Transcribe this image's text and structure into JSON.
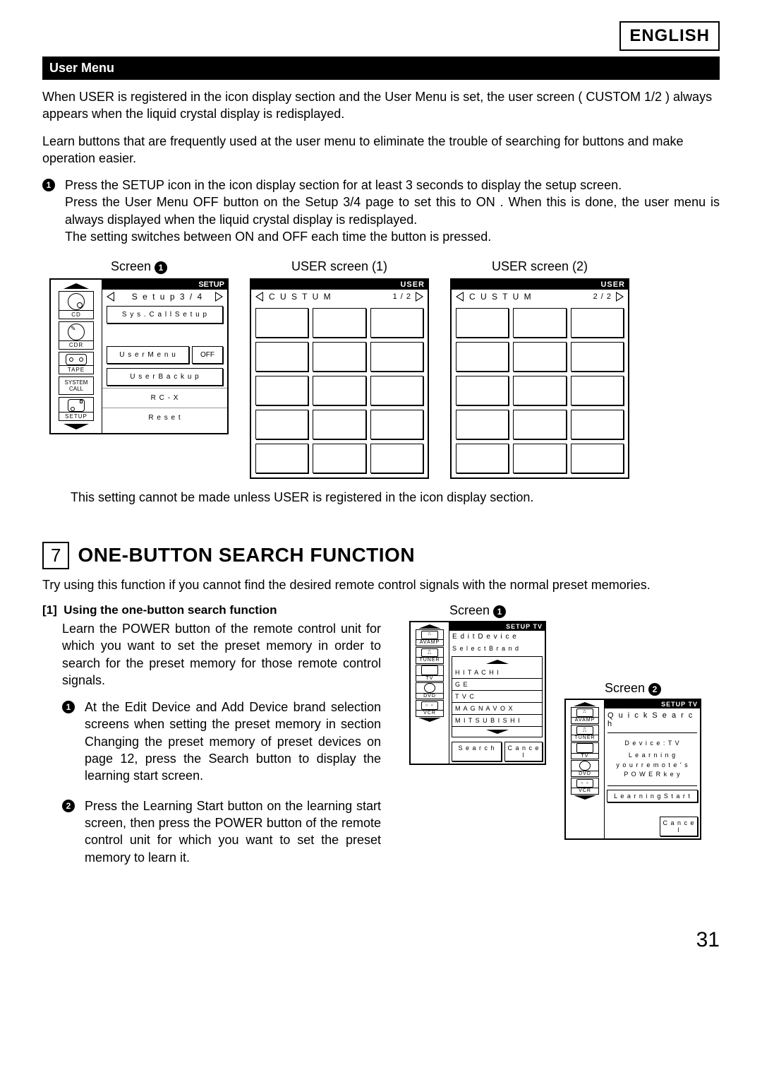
{
  "lang_tag": "ENGLISH",
  "section_bar": "User Menu",
  "intro_p1": "When  USER  is registered in the icon display section and the  User Menu  is set, the user screen ( CUSTOM 1/2 ) always appears when the liquid crystal display is redisplayed.",
  "intro_p2": " Learn  buttons that are frequently used at the user menu to eliminate the trouble of searching for buttons and make operation easier.",
  "step1": {
    "line1": "Press the  SETUP  icon in the icon display section for at least 3 seconds to display the setup screen.",
    "line2": "Press the  User Menu OFF  button on the  Setup 3/4  page to set this to  ON .  When this is done, the user menu is always displayed when the liquid crystal display is redisplayed.",
    "line3": "The setting switches between  ON  and  OFF  each time the button is pressed."
  },
  "screens": {
    "s1_label": "Screen ",
    "u1_label": "USER screen (1)",
    "u2_label": "USER screen (2)"
  },
  "lcd_setup": {
    "header": "SETUP",
    "nav_title": "S e t u p  3 / 4",
    "sidebar": {
      "cd": "CD",
      "cdr": "CDR",
      "tape": "TAPE",
      "system_call_l1": "SYSTEM",
      "system_call_l2": "CALL",
      "setup": "SETUP"
    },
    "rows": {
      "syscall": "S y s . C a l l  S e t u p",
      "usermenu": "U s e r  M e n u",
      "off": "OFF",
      "backup": "U s e r  B a c k u p",
      "rcx": "R C - X",
      "reset": "R e s e t"
    }
  },
  "lcd_user1": {
    "header": "USER",
    "title": "C U S T U M",
    "page": "1 / 2"
  },
  "lcd_user2": {
    "header": "USER",
    "title": "C U S T U M",
    "page": "2 / 2"
  },
  "note_after": "This setting cannot be made unless  USER  is registered in the icon display section.",
  "sec7": {
    "num": "7",
    "title": "ONE-BUTTON SEARCH FUNCTION",
    "lead": "Try using this function if you cannot find the desired remote control signals with the normal preset memories.",
    "sub_num": "[1]",
    "sub_title": "Using the one-button search function",
    "sub_lead": "Learn the  POWER  button of the remote control unit for which you want to set the preset memory in order to search for the preset memory for those remote control signals.",
    "b1": "At the  Edit Device  and  Add Device  brand selection screens when setting the preset memory in section  Changing the preset memory of preset devices  on page 12, press the  Search  button to display the learning start screen.",
    "b2": "Press the  Learning Start  button on the learning start screen, then press the  POWER  button of the remote control unit for which you want to set the preset memory to learn it."
  },
  "s7_screen1": {
    "label": "Screen ",
    "header": "SETUP TV",
    "title": "E d i t   D e v i c e",
    "subtitle": "S e l e c t   B r a n d",
    "sidebar": {
      "avamp": "AVAMP",
      "tuner": "TUNER",
      "tv": "TV",
      "dvd": "DVD",
      "vcr": "VCR"
    },
    "brands": [
      "H I T A C H I",
      "G E",
      "T V C",
      "M A G N A V O X",
      "M I T S U B I S H I"
    ],
    "btn_search": "S e a r c h",
    "btn_cancel": "C a n c e l"
  },
  "s7_screen2": {
    "label": "Screen ",
    "header": "SETUP TV",
    "title": "Q u i c k   S e a r c h",
    "sidebar": {
      "avamp": "AVAMP",
      "tuner": "TUNER",
      "tv": "TV",
      "dvd": "DVD",
      "vcr": "VCR"
    },
    "device_line": "D e v i c e : T V",
    "learn_l1": "L e a r n i n g",
    "learn_l2": "y o u r   r e m o t e ' s",
    "learn_l3": "P O W E R   k e y",
    "btn_start": "L e a r n i n g   S t a r t",
    "btn_cancel": "C a n c e l"
  },
  "page_number": "31"
}
